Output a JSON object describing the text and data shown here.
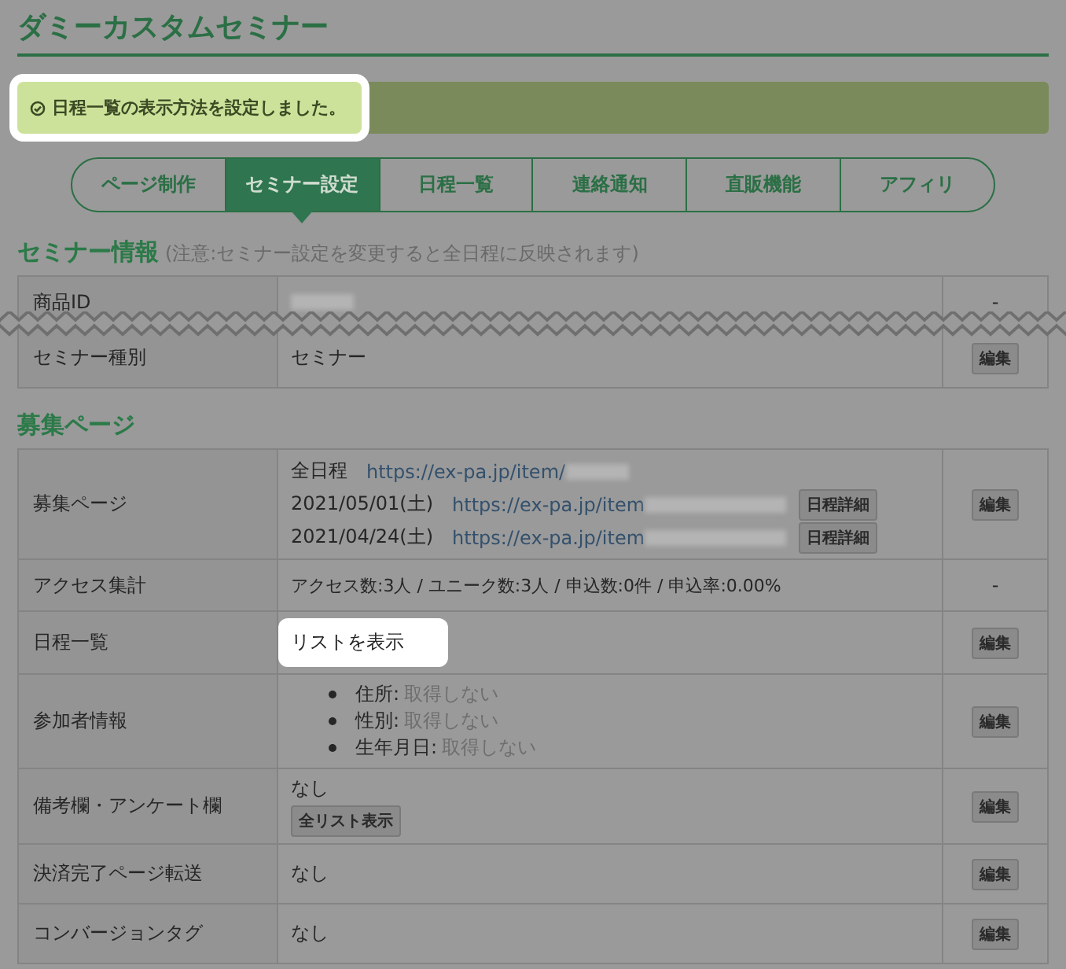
{
  "title": "ダミーカスタムセミナー",
  "notice": {
    "text": "日程一覧の表示方法を設定しました。",
    "highlighted": true
  },
  "tabs": [
    {
      "label": "ページ制作",
      "selected": false
    },
    {
      "label": "セミナー設定",
      "selected": true
    },
    {
      "label": "日程一覧",
      "selected": false
    },
    {
      "label": "連絡通知",
      "selected": false
    },
    {
      "label": "直販機能",
      "selected": false
    },
    {
      "label": "アフィリ",
      "selected": false
    }
  ],
  "info_section": {
    "heading": "セミナー情報",
    "note": "(注意:セミナー設定を変更すると全日程に反映されます)",
    "rows": [
      {
        "label": "商品ID",
        "kind": "redacted",
        "action": {
          "kind": "dash",
          "label": "-"
        },
        "break_after": true
      },
      {
        "label": "セミナー種別",
        "kind": "text",
        "value": "セミナー",
        "action": {
          "kind": "button",
          "label": "編集"
        }
      }
    ]
  },
  "recruit_section": {
    "heading": "募集ページ",
    "rows": [
      {
        "label": "募集ページ",
        "kind": "links",
        "lines": [
          {
            "prefix": "全日程",
            "url": "https://ex-pa.jp/item/"
          },
          {
            "prefix": "2021/05/01(土)",
            "url": "https://ex-pa.jp/item",
            "button": "日程詳細"
          },
          {
            "prefix": "2021/04/24(土)",
            "url": "https://ex-pa.jp/item",
            "button": "日程詳細"
          }
        ],
        "action": {
          "kind": "button",
          "label": "編集"
        }
      },
      {
        "label": "アクセス集計",
        "kind": "small",
        "value": "アクセス数:3人 / ユニーク数:3人 / 申込数:0件 / 申込率:0.00%",
        "action": {
          "kind": "dash",
          "label": "-"
        }
      },
      {
        "label": "日程一覧",
        "kind": "text",
        "value": "リストを表示",
        "highlighted": true,
        "action": {
          "kind": "button",
          "label": "編集"
        }
      },
      {
        "label": "参加者情報",
        "kind": "list",
        "items": [
          {
            "name": "住所:",
            "value": "取得しない"
          },
          {
            "name": "性別:",
            "value": "取得しない"
          },
          {
            "name": "生年月日:",
            "value": "取得しない"
          }
        ],
        "action": {
          "kind": "button",
          "label": "編集"
        }
      },
      {
        "label": "備考欄・アンケート欄",
        "kind": "text_button",
        "value": "なし",
        "button": "全リスト表示",
        "action": {
          "kind": "button",
          "label": "編集"
        }
      },
      {
        "label": "決済完了ページ転送",
        "kind": "text",
        "value": "なし",
        "action": {
          "kind": "button",
          "label": "編集"
        }
      },
      {
        "label": "コンバージョンタグ",
        "kind": "text",
        "value": "なし",
        "action": {
          "kind": "button",
          "label": "編集"
        }
      }
    ]
  }
}
